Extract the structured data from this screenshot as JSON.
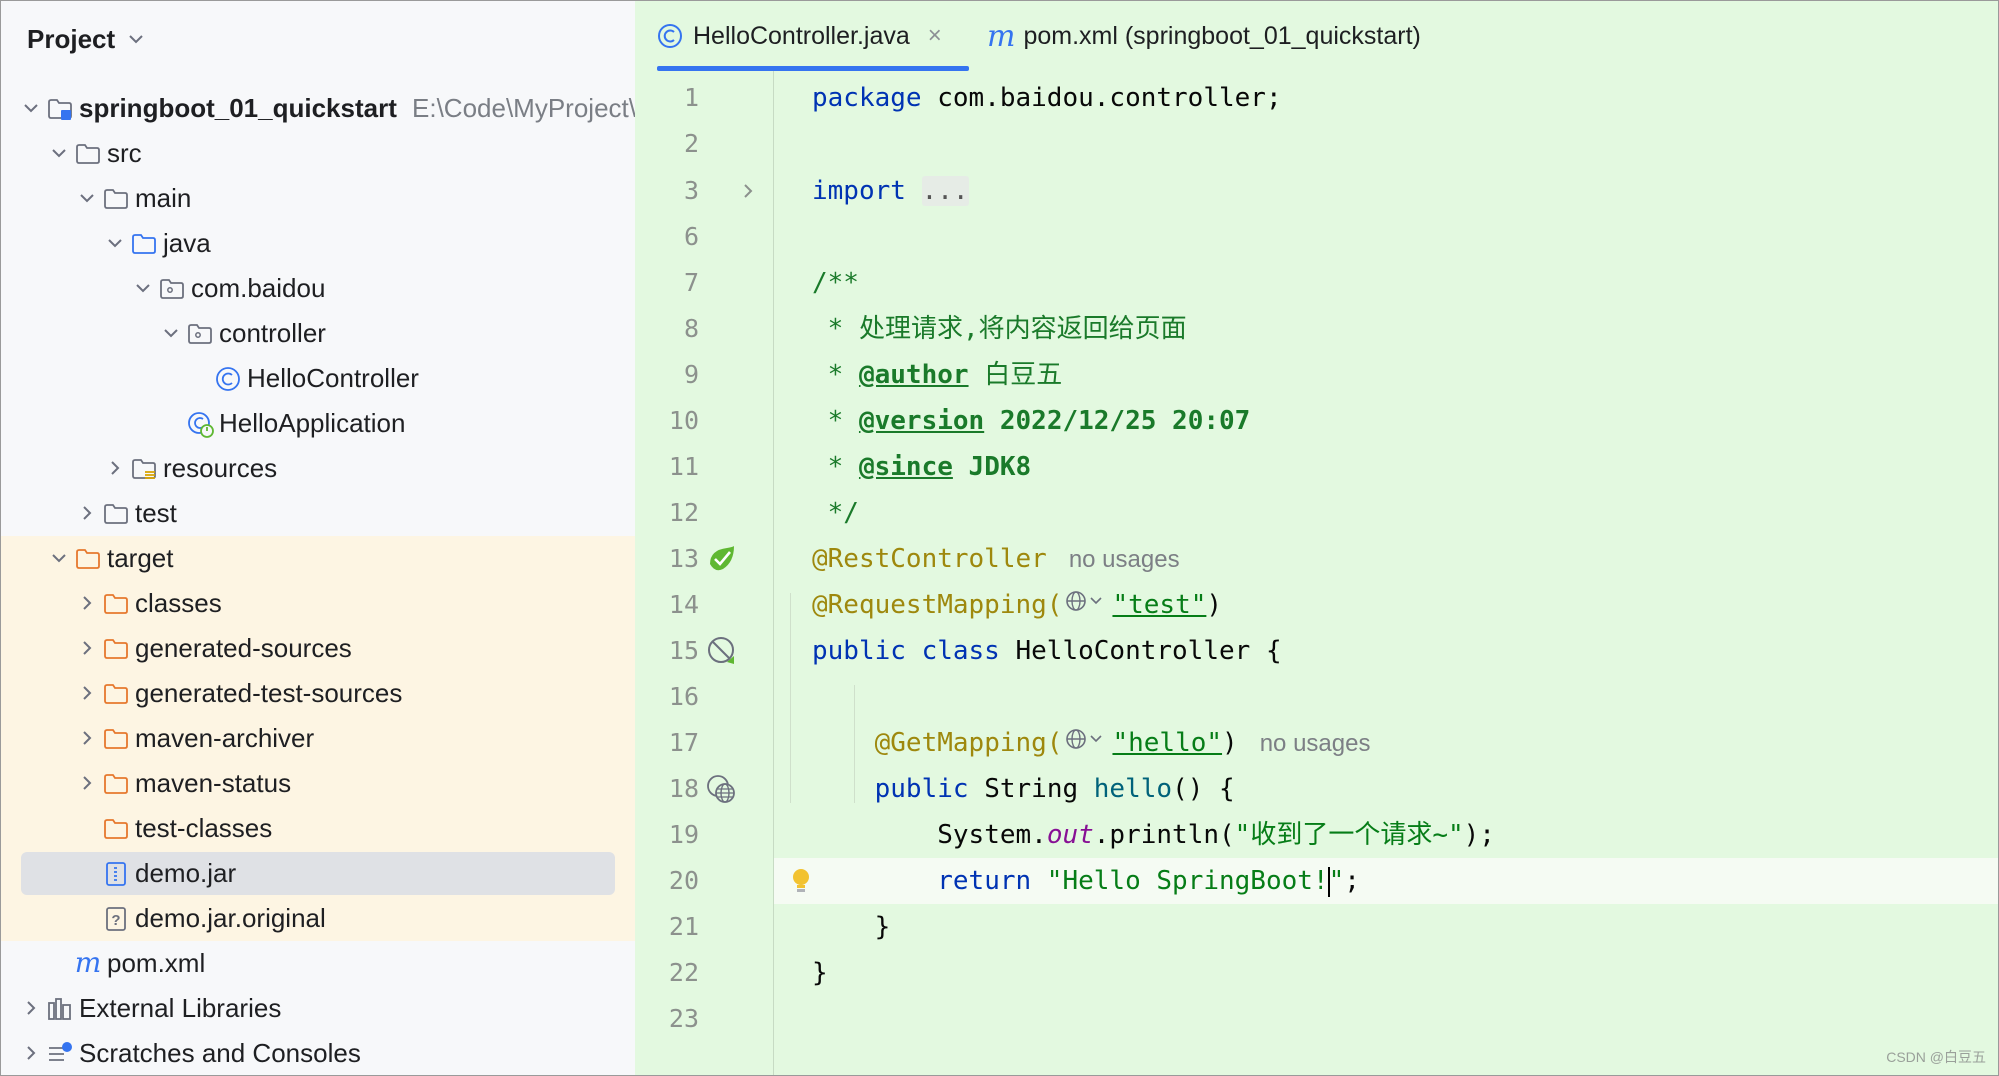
{
  "project": {
    "title": "Project",
    "tree": [
      {
        "label": "springboot_01_quickstart",
        "path": "E:\\Code\\MyProject\\",
        "depth": 0,
        "expanded": true,
        "icon": "module-folder-icon",
        "bold": true,
        "highlight": false
      },
      {
        "label": "src",
        "depth": 1,
        "expanded": true,
        "icon": "folder-icon"
      },
      {
        "label": "main",
        "depth": 2,
        "expanded": true,
        "icon": "folder-icon"
      },
      {
        "label": "java",
        "depth": 3,
        "expanded": true,
        "icon": "source-folder-icon"
      },
      {
        "label": "com.baidou",
        "depth": 4,
        "expanded": true,
        "icon": "package-icon"
      },
      {
        "label": "controller",
        "depth": 5,
        "expanded": true,
        "icon": "package-icon"
      },
      {
        "label": "HelloController",
        "depth": 6,
        "icon": "class-icon"
      },
      {
        "label": "HelloApplication",
        "depth": 5,
        "icon": "springboot-class-icon"
      },
      {
        "label": "resources",
        "depth": 3,
        "expanded": false,
        "icon": "resources-folder-icon"
      },
      {
        "label": "test",
        "depth": 2,
        "expanded": false,
        "icon": "folder-icon"
      },
      {
        "label": "target",
        "depth": 1,
        "expanded": true,
        "icon": "excluded-folder-icon",
        "highlight": true
      },
      {
        "label": "classes",
        "depth": 2,
        "expanded": false,
        "icon": "excluded-folder-icon",
        "highlight": true
      },
      {
        "label": "generated-sources",
        "depth": 2,
        "expanded": false,
        "icon": "excluded-folder-icon",
        "highlight": true
      },
      {
        "label": "generated-test-sources",
        "depth": 2,
        "expanded": false,
        "icon": "excluded-folder-icon",
        "highlight": true
      },
      {
        "label": "maven-archiver",
        "depth": 2,
        "expanded": false,
        "icon": "excluded-folder-icon",
        "highlight": true
      },
      {
        "label": "maven-status",
        "depth": 2,
        "expanded": false,
        "icon": "excluded-folder-icon",
        "highlight": true
      },
      {
        "label": "test-classes",
        "depth": 2,
        "icon": "excluded-folder-icon",
        "highlight": true
      },
      {
        "label": "demo.jar",
        "depth": 2,
        "icon": "jar-file-icon",
        "highlight": true,
        "selected": true
      },
      {
        "label": "demo.jar.original",
        "depth": 2,
        "icon": "unknown-file-icon",
        "highlight": true
      },
      {
        "label": "pom.xml",
        "depth": 1,
        "icon": "maven-file-icon"
      },
      {
        "label": "External Libraries",
        "depth": 0,
        "expanded": false,
        "icon": "libraries-icon"
      },
      {
        "label": "Scratches and Consoles",
        "depth": 0,
        "expanded": false,
        "icon": "scratches-icon"
      }
    ]
  },
  "editor": {
    "tabs": [
      {
        "label": "HelloController.java",
        "icon": "class-icon",
        "active": true,
        "close": "×"
      },
      {
        "label": "pom.xml (springboot_01_quickstart)",
        "icon": "maven-file-icon",
        "active": false
      }
    ],
    "lines": [
      {
        "num": "1"
      },
      {
        "num": "2"
      },
      {
        "num": "3"
      },
      {
        "num": "6"
      },
      {
        "num": "7"
      },
      {
        "num": "8"
      },
      {
        "num": "9"
      },
      {
        "num": "10"
      },
      {
        "num": "11"
      },
      {
        "num": "12"
      },
      {
        "num": "13"
      },
      {
        "num": "14"
      },
      {
        "num": "15"
      },
      {
        "num": "16"
      },
      {
        "num": "17"
      },
      {
        "num": "18"
      },
      {
        "num": "19"
      },
      {
        "num": "20"
      },
      {
        "num": "21"
      },
      {
        "num": "22"
      },
      {
        "num": "23"
      }
    ],
    "code": {
      "l1_kw": "package",
      "l1_rest": " com.baidou.controller;",
      "l3_kw": "import",
      "l3_fold": "...",
      "l7": "/**",
      "l8": " * 处理请求,将内容返回给页面",
      "l9_star": " * ",
      "l9_tag": "@author",
      "l9_val": " 白豆五",
      "l10_star": " * ",
      "l10_tag": "@version",
      "l10_val": " 2022/12/25 20:07",
      "l11_star": " * ",
      "l11_tag": "@since",
      "l11_val": " JDK8",
      "l12": " */",
      "l13_ann": "@RestController",
      "l13_hint": "no usages",
      "l14_ann": "@RequestMapping(",
      "l14_str": "\"test\"",
      "l14_end": ")",
      "l15_kw": "public class",
      "l15_rest": " HelloController {",
      "l17_indent": "    ",
      "l17_ann": "@GetMapping(",
      "l17_str": "\"hello\"",
      "l17_end": ")",
      "l17_hint": "no usages",
      "l18_indent": "    ",
      "l18_kw": "public",
      "l18_type": " String ",
      "l18_mth": "hello",
      "l18_rest": "() {",
      "l19_indent": "        ",
      "l19_a": "System.",
      "l19_fld": "out",
      "l19_b": ".println(",
      "l19_str": "\"收到了一个请求~\"",
      "l19_c": ");",
      "l20_indent": "        ",
      "l20_kw": "return",
      "l20_str1": " \"Hello SpringBoot!",
      "l20_str2": "\"",
      "l20_end": ";",
      "l21": "    }",
      "l22": "}"
    }
  },
  "watermark": "CSDN @白豆五"
}
